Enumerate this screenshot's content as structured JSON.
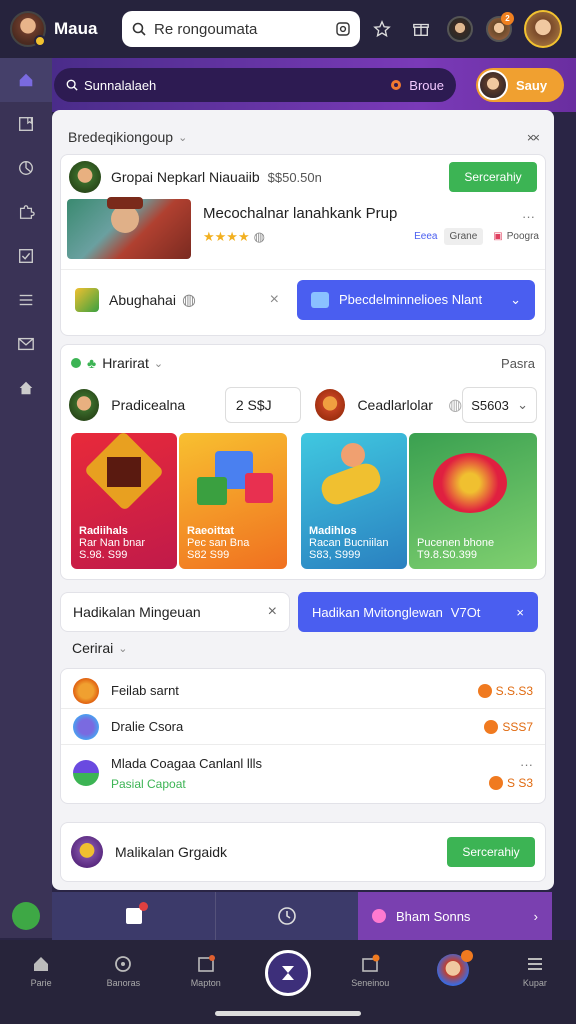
{
  "topbar": {
    "app_title": "Maua",
    "search_placeholder": "Re rongoumata"
  },
  "purplebar": {
    "search_text": "Sunnalalaeh",
    "group_label": "Broue",
    "sign_label": "Sauy"
  },
  "panel": {
    "title": "Bredeqikiongoup",
    "close_label": "××"
  },
  "featured": {
    "header_name": "Gropai Nepkarl Niauaiib",
    "header_price": "$$50.50n",
    "header_button": "Sercerahiy",
    "banner_title": "Mecochalnar lanahkank Prup",
    "banner_rating": "★★★★",
    "banner_tag": "Eeea",
    "banner_chip": "Grane",
    "banner_link": "Poogra",
    "more": "···",
    "row_label": "Abughahai",
    "row_button": "Pbecdelminnelioes Nlant"
  },
  "section2": {
    "title": "Hrarirat",
    "right_label": "Pasra",
    "left_item": "Pradicealna",
    "left_price": "2 S$J",
    "right_item": "Ceadlarlolar",
    "right_select": "S5603",
    "tiles": [
      {
        "title": "Radiihals",
        "sub": "Rar Nan bnar",
        "price": "S.98. S99"
      },
      {
        "title": "Raeoittat",
        "sub": "Pec san Bna",
        "price": "S82 S99"
      },
      {
        "title": "Madihlos",
        "sub": "Racan Bucniilan",
        "price": "S83, S999"
      },
      {
        "title": "",
        "sub": "Pucenen bhone",
        "price": "T9.8.S0.399"
      }
    ]
  },
  "section3": {
    "input_label": "Hadikalan Mingeuan",
    "close": "×",
    "button_label": "Hadikan Mvitonglewan",
    "button_value": "V7Ot"
  },
  "section4": {
    "title": "Cerirai",
    "rows": [
      {
        "label": "Feilab sarnt",
        "value": "S.S.S3"
      },
      {
        "label": "Dralie Csora",
        "value": "SSS7"
      },
      {
        "label": "Mlada Coagaa Canlanl llls",
        "sub": "Pasial Capoat",
        "value": "S S3"
      }
    ],
    "more": "···"
  },
  "footer_card": {
    "label": "Malikalan Grgaidk",
    "button": "Sercerahiy"
  },
  "dock": {
    "right_label": "Bham Sonns"
  },
  "bottomnav": {
    "items": [
      "Parie",
      "Banoras",
      "Mapton",
      "",
      "Seneinou",
      "Kupar"
    ]
  },
  "colors": {
    "accent_purple": "#7a3ab8",
    "green": "#3cb454",
    "blue": "#4a5ef0",
    "orange": "#f0a030"
  }
}
